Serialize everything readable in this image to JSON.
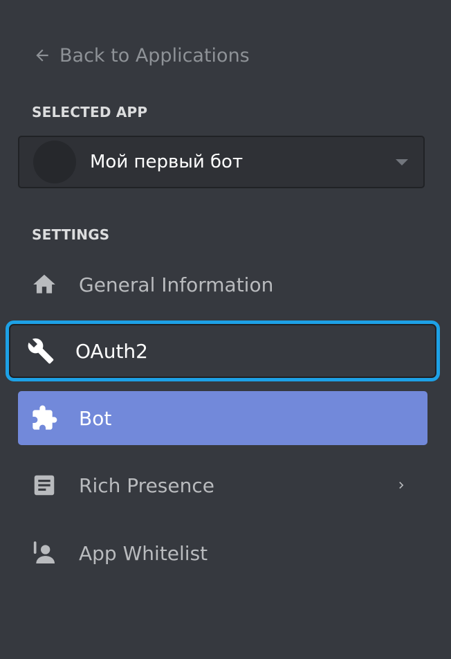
{
  "back": {
    "label": "Back to Applications"
  },
  "selected_app": {
    "header": "SELECTED APP",
    "name": "Мой первый бот"
  },
  "settings": {
    "header": "SETTINGS",
    "items": [
      {
        "label": "General Information",
        "icon": "home-icon"
      },
      {
        "label": "OAuth2",
        "icon": "wrench-icon"
      },
      {
        "label": "Bot",
        "icon": "puzzle-icon",
        "active": true
      },
      {
        "label": "Rich Presence",
        "icon": "document-icon",
        "has_submenu": true
      },
      {
        "label": "App Whitelist",
        "icon": "user-contact-icon"
      }
    ]
  },
  "colors": {
    "background": "#36393f",
    "active_item": "#7289da",
    "highlight_border": "#1da1e6"
  }
}
